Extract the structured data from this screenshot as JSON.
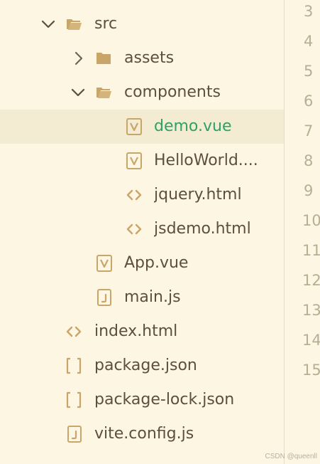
{
  "explorer": {
    "items": [
      {
        "label": "src",
        "icon": "folder-open-icon",
        "expanded": true
      },
      {
        "label": "assets",
        "icon": "folder-icon",
        "expanded": false
      },
      {
        "label": "components",
        "icon": "folder-open-icon",
        "expanded": true
      },
      {
        "label": "demo.vue",
        "icon": "vue-file-icon",
        "selected": true
      },
      {
        "label": "HelloWorld....",
        "icon": "vue-file-icon"
      },
      {
        "label": "jquery.html",
        "icon": "html-file-icon"
      },
      {
        "label": "jsdemo.html",
        "icon": "html-file-icon"
      },
      {
        "label": "App.vue",
        "icon": "vue-file-icon"
      },
      {
        "label": "main.js",
        "icon": "js-file-icon"
      },
      {
        "label": "index.html",
        "icon": "html-file-icon"
      },
      {
        "label": "package.json",
        "icon": "json-file-icon"
      },
      {
        "label": "package-lock.json",
        "icon": "json-file-icon"
      },
      {
        "label": "vite.config.js",
        "icon": "js-file-icon"
      }
    ]
  },
  "editor": {
    "line_numbers": [
      "3",
      "4",
      "5",
      "6",
      "7",
      "8",
      "9",
      "10",
      "11",
      "12",
      "13",
      "14",
      "15"
    ]
  },
  "watermark": "CSDN @queenll",
  "colors": {
    "background": "#fdf6e3",
    "selected_row": "#f3ebd2",
    "selected_text": "#2ea264",
    "text": "#5d4f3a",
    "icon": "#c9a56a"
  }
}
